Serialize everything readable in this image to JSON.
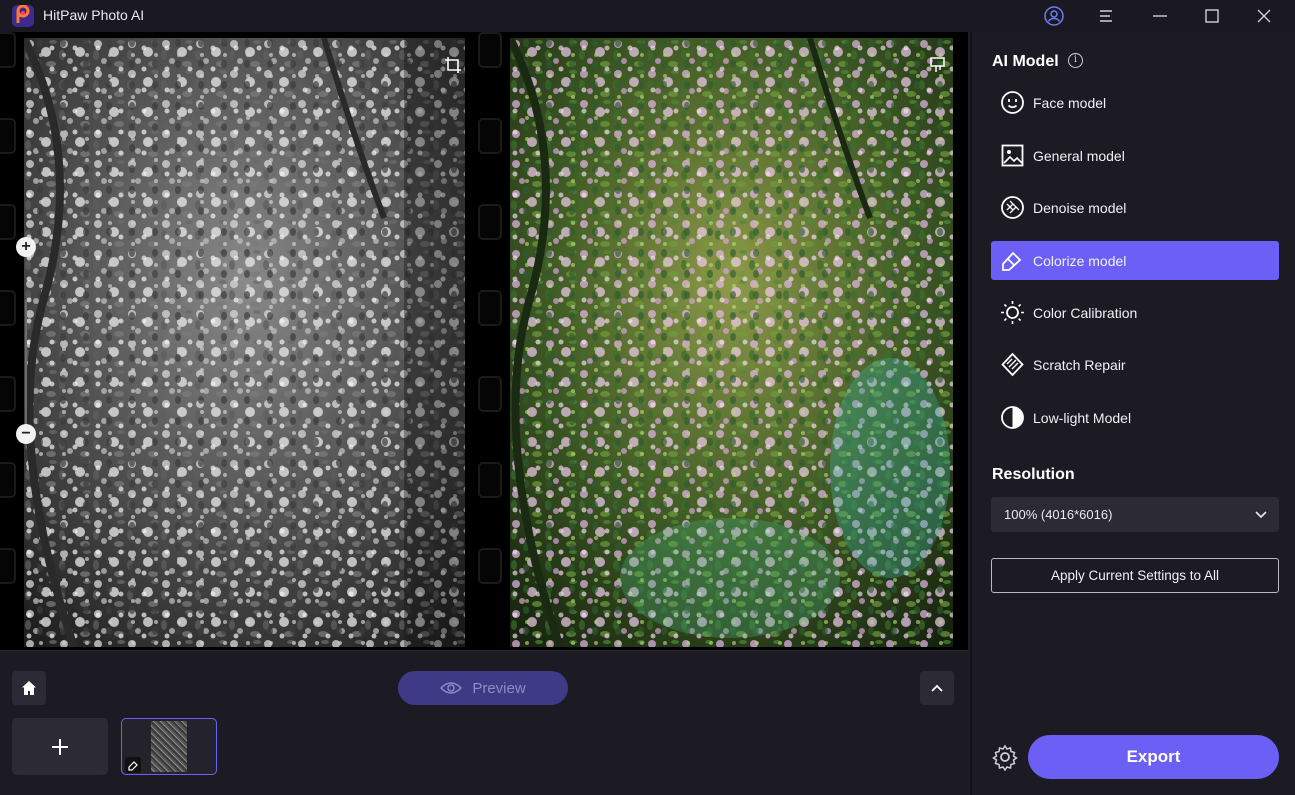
{
  "window": {
    "app_title": "HitPaw Photo AI",
    "controls": [
      "account-icon",
      "menu-icon",
      "minimize-icon",
      "maximize-icon",
      "close-icon"
    ]
  },
  "workspace": {
    "left_image": "original-grayscale-photo",
    "right_image": "colorized-result-photo"
  },
  "bottom": {
    "preview_label": "Preview"
  },
  "sidebar": {
    "ai_model_title": "AI Model",
    "models": [
      {
        "label": "Face model",
        "icon": "face-icon",
        "active": false
      },
      {
        "label": "General model",
        "icon": "image-icon",
        "active": false
      },
      {
        "label": "Denoise model",
        "icon": "denoise-icon",
        "active": false
      },
      {
        "label": "Colorize model",
        "icon": "colorize-icon",
        "active": true
      },
      {
        "label": "Color Calibration",
        "icon": "sun-icon",
        "active": false
      },
      {
        "label": "Scratch Repair",
        "icon": "scratch-icon",
        "active": false
      },
      {
        "label": "Low-light Model",
        "icon": "half-circle-icon",
        "active": false
      }
    ],
    "resolution_title": "Resolution",
    "resolution_value": "100% (4016*6016)",
    "apply_label": "Apply Current Settings to All",
    "export_label": "Export"
  },
  "colors": {
    "accent": "#6c5ff6",
    "preview_button": "#3f3a86",
    "panel_bg": "#1c1b24"
  }
}
